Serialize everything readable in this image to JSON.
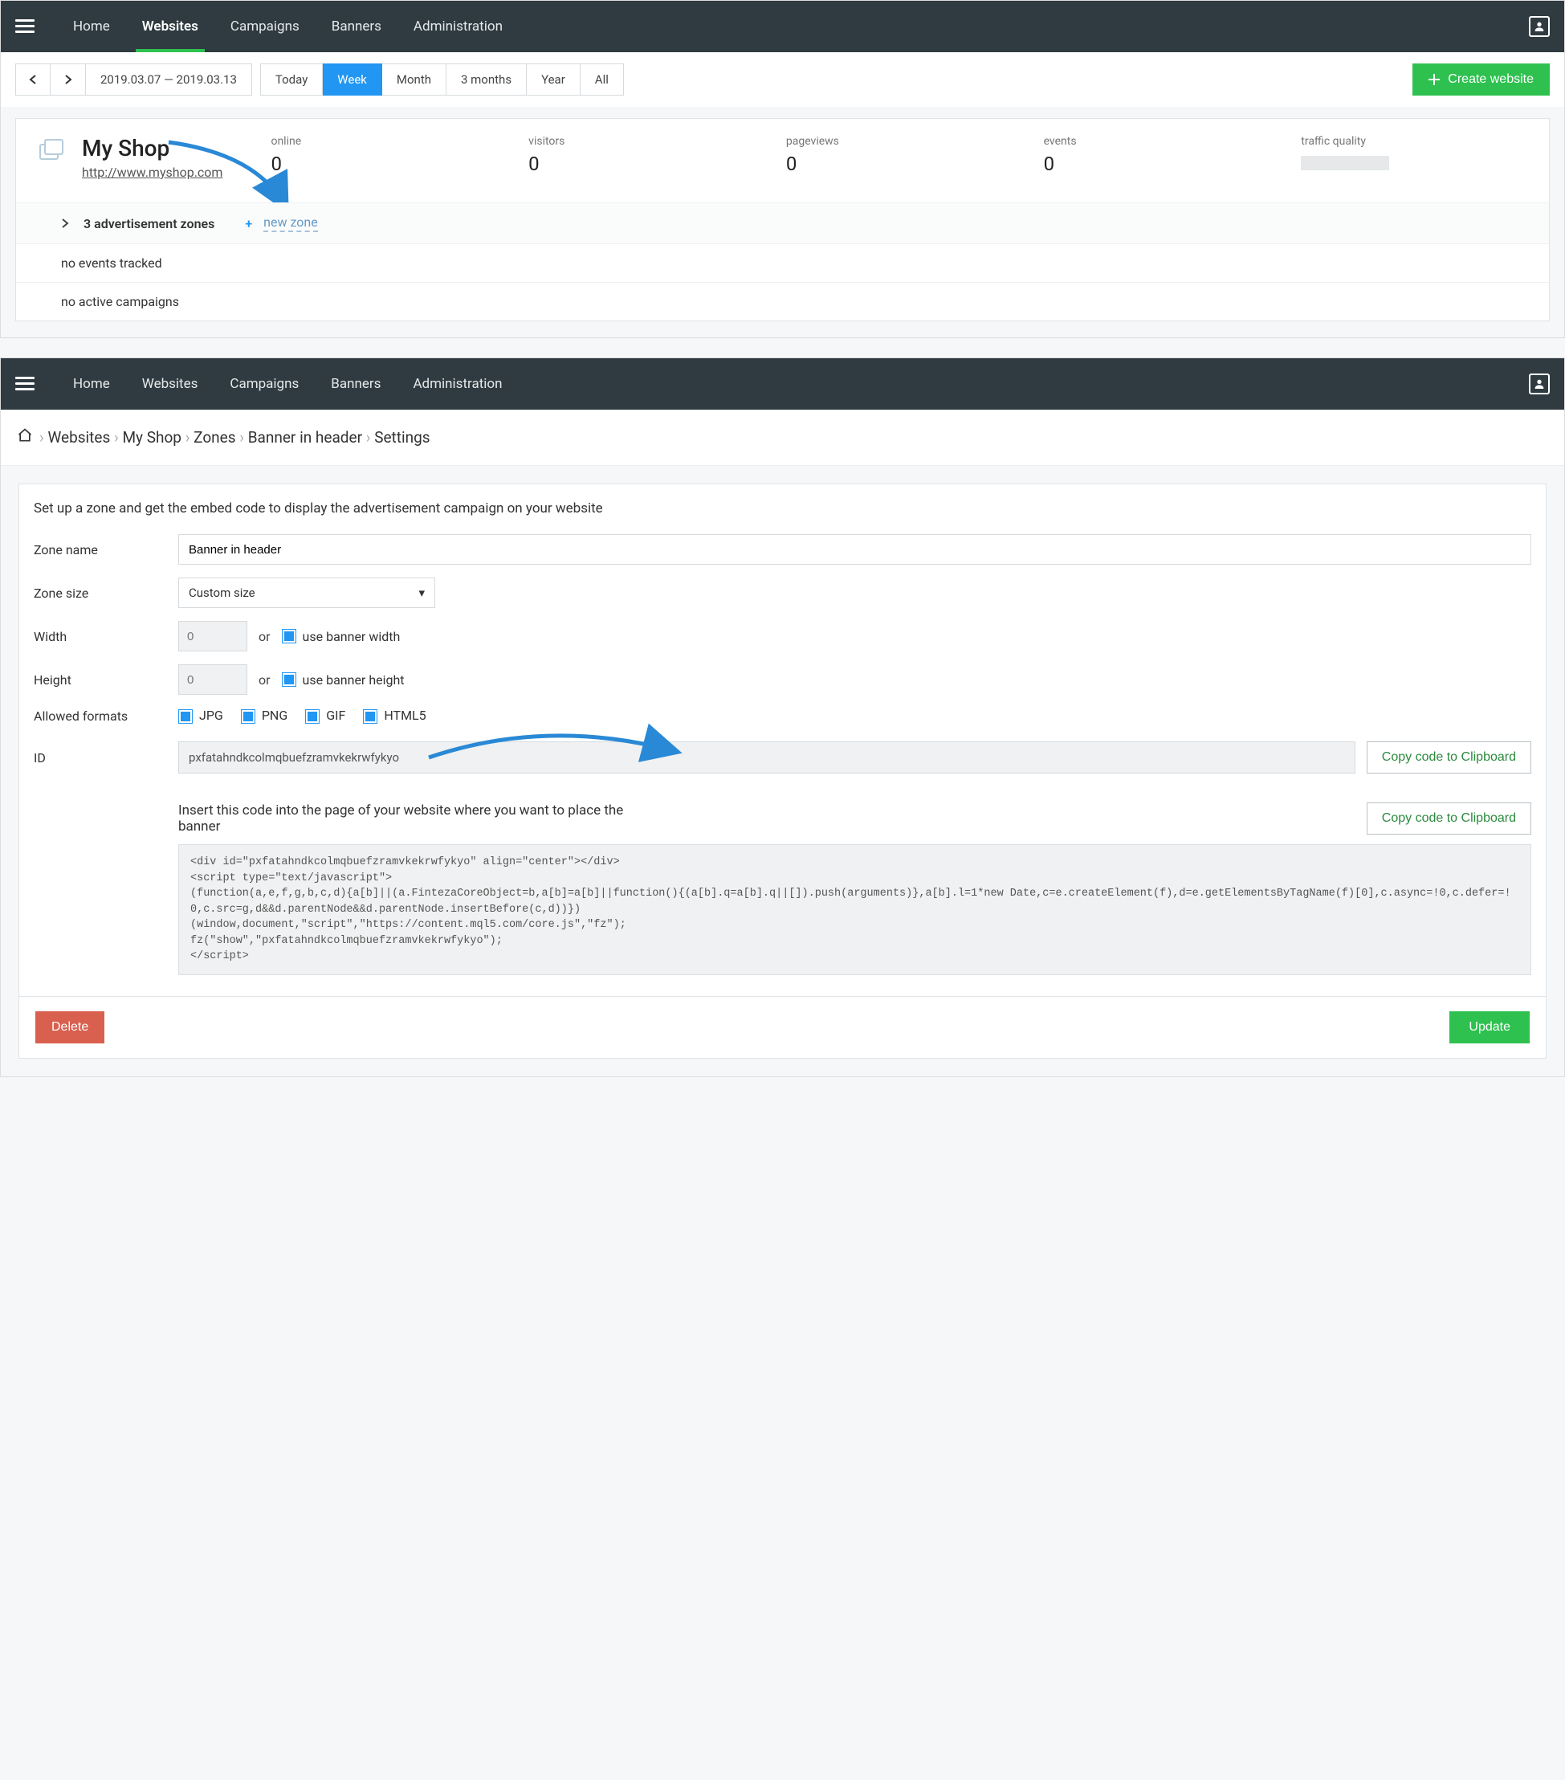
{
  "nav": {
    "items": [
      "Home",
      "Websites",
      "Campaigns",
      "Banners",
      "Administration"
    ],
    "active": "Websites"
  },
  "dateRange": {
    "from": "2019.03.07",
    "to": "2019.03.13",
    "sep": "—"
  },
  "ranges": [
    "Today",
    "Week",
    "Month",
    "3 months",
    "Year",
    "All"
  ],
  "rangesActive": "Week",
  "createWebsite": "Create website",
  "site": {
    "name": "My Shop",
    "url": "http://www.myshop.com"
  },
  "stats": [
    {
      "label": "online",
      "value": "0"
    },
    {
      "label": "visitors",
      "value": "0"
    },
    {
      "label": "pageviews",
      "value": "0"
    },
    {
      "label": "events",
      "value": "0"
    },
    {
      "label": "traffic quality",
      "value": ""
    }
  ],
  "rows": {
    "zones": "3 advertisement zones",
    "newZone": "new zone",
    "noEvents": "no events tracked",
    "noCampaigns": "no active campaigns"
  },
  "breadcrumb": [
    "Websites",
    "My Shop",
    "Zones",
    "Banner in header",
    "Settings"
  ],
  "form": {
    "intro": "Set up a zone and get the embed code to display the advertisement campaign on your website",
    "labels": {
      "zoneName": "Zone name",
      "zoneSize": "Zone size",
      "width": "Width",
      "height": "Height",
      "allowed": "Allowed formats",
      "id": "ID"
    },
    "zoneName": "Banner in header",
    "zoneSize": "Custom size",
    "widthPlaceholder": "0",
    "heightPlaceholder": "0",
    "or": "or",
    "useBannerWidth": "use banner width",
    "useBannerHeight": "use banner height",
    "formats": [
      "JPG",
      "PNG",
      "GIF",
      "HTML5"
    ],
    "id": "pxfatahndkcolmqbuefzramvkekrwfykyo",
    "copy": "Copy code to Clipboard",
    "insertText": "Insert this code into the page of your website where you want to place the banner",
    "code": "<div id=\"pxfatahndkcolmqbuefzramvkekrwfykyo\" align=\"center\"></div>\n<script type=\"text/javascript\">\n(function(a,e,f,g,b,c,d){a[b]||(a.FintezaCoreObject=b,a[b]=a[b]||function(){(a[b].q=a[b].q||[]).push(arguments)},a[b].l=1*new Date,c=e.createElement(f),d=e.getElementsByTagName(f)[0],c.async=!0,c.defer=!0,c.src=g,d&&d.parentNode&&d.parentNode.insertBefore(c,d))})\n(window,document,\"script\",\"https://content.mql5.com/core.js\",\"fz\");\nfz(\"show\",\"pxfatahndkcolmqbuefzramvkekrwfykyo\");\n</script>",
    "delete": "Delete",
    "update": "Update"
  }
}
